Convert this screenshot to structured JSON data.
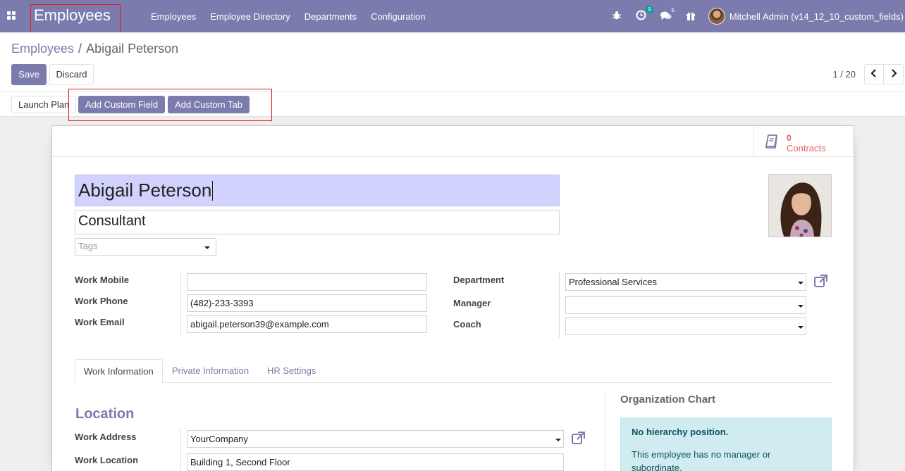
{
  "navbar": {
    "app_title": "Employees",
    "menu": [
      "Employees",
      "Employee Directory",
      "Departments",
      "Configuration"
    ],
    "activity_count": "9",
    "messages_count": "5",
    "user_name": "Mitchell Admin (v14_12_10_custom_fields)"
  },
  "breadcrumb": {
    "parent": "Employees",
    "separator": "/",
    "current": "Abigail Peterson"
  },
  "actions": {
    "save": "Save",
    "discard": "Discard"
  },
  "pager": {
    "value": "1 / 20"
  },
  "header_buttons": {
    "launch_plan": "Launch Plan",
    "add_custom_field": "Add Custom Field",
    "add_custom_tab": "Add Custom Tab"
  },
  "stat_button": {
    "value": "0",
    "label": "Contracts"
  },
  "employee": {
    "name": "Abigail Peterson",
    "job_title": "Consultant",
    "tags_placeholder": "Tags"
  },
  "contact": {
    "work_mobile_label": "Work Mobile",
    "work_mobile": "",
    "work_phone_label": "Work Phone",
    "work_phone": "(482)-233-3393",
    "work_email_label": "Work Email",
    "work_email": "abigail.peterson39@example.com"
  },
  "org": {
    "department_label": "Department",
    "department": "Professional Services",
    "manager_label": "Manager",
    "manager": "",
    "coach_label": "Coach",
    "coach": ""
  },
  "tabs": [
    "Work Information",
    "Private Information",
    "HR Settings"
  ],
  "work_info": {
    "section_title": "Location",
    "work_address_label": "Work Address",
    "work_address": "YourCompany",
    "work_location_label": "Work Location",
    "work_location": "Building 1, Second Floor"
  },
  "org_chart": {
    "title": "Organization Chart",
    "heading": "No hierarchy position.",
    "body": "This employee has no manager or subordinate."
  },
  "colors": {
    "brand": "#7c7bad",
    "highlight_annotation": "#e01b1b",
    "stat": "#e46060",
    "name_field_bg": "#d2d2ff"
  }
}
